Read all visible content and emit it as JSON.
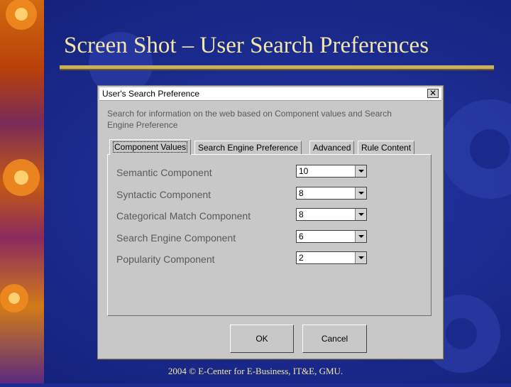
{
  "slide": {
    "title": "Screen Shot – User Search Preferences",
    "footer": "2004 © E-Center for E-Business, IT&E, GMU."
  },
  "dialog": {
    "title": "User's Search Preference",
    "close_symbol": "✕",
    "description": "Search for information on the web based on Component values and Search Engine Preference",
    "tabs": [
      {
        "label": "Component Values",
        "active": true
      },
      {
        "label": "Search Engine Preference",
        "active": false
      },
      {
        "label": "Advanced",
        "active": false
      },
      {
        "label": "Rule Content",
        "active": false
      }
    ],
    "rows": [
      {
        "label": "Semantic Component",
        "value": "10"
      },
      {
        "label": "Syntactic Component",
        "value": "8"
      },
      {
        "label": "Categorical Match Component",
        "value": "8"
      },
      {
        "label": "Search Engine Component",
        "value": "6"
      },
      {
        "label": "Popularity Component",
        "value": "2"
      }
    ],
    "ok_label": "OK",
    "cancel_label": "Cancel"
  },
  "colors": {
    "background": "#1c2b8f",
    "title_text": "#f3e6a8",
    "dialog_face": "#c8c8c8"
  }
}
